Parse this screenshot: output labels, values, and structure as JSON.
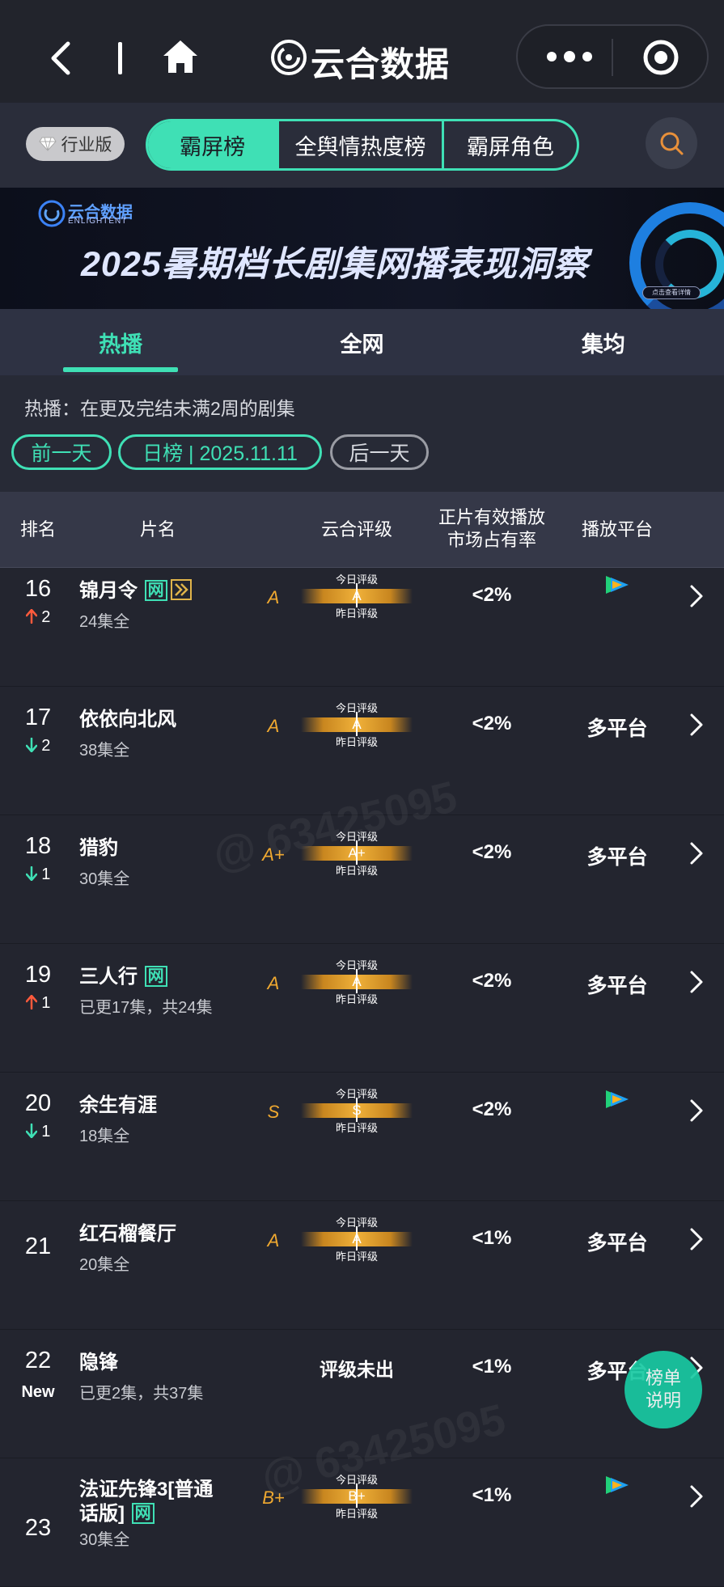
{
  "app": {
    "title": "云合数据"
  },
  "segments": [
    {
      "label": "霸屏榜",
      "active": true
    },
    {
      "label": "全舆情热度榜",
      "active": false
    },
    {
      "label": "霸屏角色",
      "active": false
    }
  ],
  "industry_badge": "行业版",
  "banner": {
    "brand": "云合数据",
    "brand_en": "ENLIGHTENT",
    "title": "2025暑期档长剧集网播表现洞察",
    "button": "点击查看详情"
  },
  "tabs": [
    "热播",
    "全网",
    "集均"
  ],
  "description": "热播：在更及完结未满2周的剧集",
  "date_nav": {
    "prev": "前一天",
    "current": "日榜 | 2025.11.11",
    "next": "后一天"
  },
  "table_header": {
    "rank": "排名",
    "title": "片名",
    "rating": "云合评级",
    "share_line1": "正片有效播放",
    "share_line2": "市场占有率",
    "platform": "播放平台"
  },
  "grade_labels": {
    "today": "今日评级",
    "yesterday": "昨日评级",
    "pending": "评级未出"
  },
  "rows": [
    {
      "rank": "16",
      "change": "2",
      "trend": "up",
      "title": "锦月令",
      "web_tag": "网",
      "eps": "24集全",
      "grade": "A",
      "today": "A",
      "yesterday": "A",
      "share": "<2%",
      "platform": "",
      "platform_icon": "tencent-video"
    },
    {
      "rank": "17",
      "change": "2",
      "trend": "down",
      "title": "依依向北风",
      "web_tag": "",
      "eps": "38集全",
      "grade": "A",
      "today": "A",
      "yesterday": "A",
      "share": "<2%",
      "platform": "多平台",
      "platform_icon": ""
    },
    {
      "rank": "18",
      "change": "1",
      "trend": "down",
      "title": "猎豹",
      "web_tag": "",
      "eps": "30集全",
      "grade": "A+",
      "today": "A+",
      "yesterday": "A+",
      "share": "<2%",
      "platform": "多平台",
      "platform_icon": ""
    },
    {
      "rank": "19",
      "change": "1",
      "trend": "up",
      "title": "三人行",
      "web_tag": "网",
      "eps": "已更17集，共24集",
      "grade": "A",
      "today": "A",
      "yesterday": "A",
      "share": "<2%",
      "platform": "多平台",
      "platform_icon": ""
    },
    {
      "rank": "20",
      "change": "1",
      "trend": "down",
      "title": "余生有涯",
      "web_tag": "",
      "eps": "18集全",
      "grade": "S",
      "today": "S",
      "yesterday": "S",
      "share": "<2%",
      "platform": "",
      "platform_icon": "tencent-video"
    },
    {
      "rank": "21",
      "change": "",
      "trend": "none",
      "title": "红石榴餐厅",
      "web_tag": "",
      "eps": "20集全",
      "grade": "A",
      "today": "A",
      "yesterday": "A",
      "share": "<1%",
      "platform": "多平台",
      "platform_icon": ""
    },
    {
      "rank": "22",
      "change": "New",
      "trend": "new",
      "title": "隐锋",
      "web_tag": "",
      "eps": "已更2集，共37集",
      "grade": "",
      "today": "",
      "yesterday": "",
      "share": "<1%",
      "platform": "多平台",
      "platform_icon": ""
    },
    {
      "rank": "23",
      "change": "",
      "trend": "none",
      "title_line1": "法证先锋3[普通",
      "title_line2": "话版]",
      "web_tag": "网",
      "eps": "30集全",
      "grade": "B+",
      "today": "B+",
      "yesterday": "B",
      "share": "<1%",
      "platform": "",
      "platform_icon": "tencent-video"
    }
  ],
  "fab": {
    "line1": "榜单",
    "line2": "说明"
  },
  "watermark": "@ 63425095",
  "colors": {
    "accent": "#3fe0b5",
    "up": "#ff5a3c",
    "down": "#3fe0b5",
    "grade": "#f0a930",
    "background": "#23252f"
  }
}
